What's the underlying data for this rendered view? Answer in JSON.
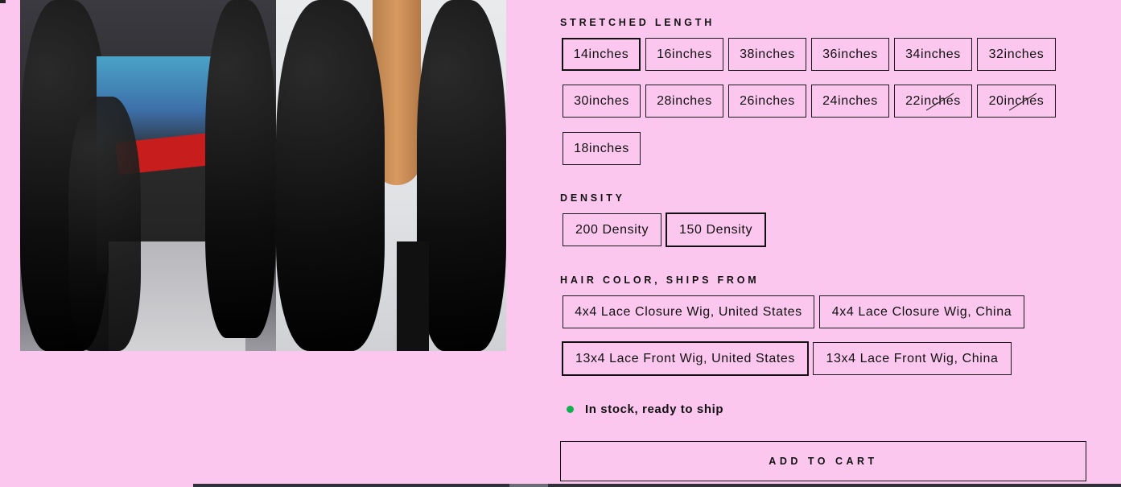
{
  "stretched_length": {
    "label": "STRETCHED LENGTH",
    "options": [
      {
        "label": "14inches",
        "selected": true,
        "sold_out": false
      },
      {
        "label": "16inches",
        "selected": false,
        "sold_out": false
      },
      {
        "label": "38inches",
        "selected": false,
        "sold_out": false
      },
      {
        "label": "36inches",
        "selected": false,
        "sold_out": false
      },
      {
        "label": "34inches",
        "selected": false,
        "sold_out": false
      },
      {
        "label": "32inches",
        "selected": false,
        "sold_out": false
      },
      {
        "label": "30inches",
        "selected": false,
        "sold_out": false
      },
      {
        "label": "28inches",
        "selected": false,
        "sold_out": false
      },
      {
        "label": "26inches",
        "selected": false,
        "sold_out": false
      },
      {
        "label": "24inches",
        "selected": false,
        "sold_out": false
      },
      {
        "label": "22inches",
        "selected": false,
        "sold_out": true
      },
      {
        "label": "20inches",
        "selected": false,
        "sold_out": true
      },
      {
        "label": "18inches",
        "selected": false,
        "sold_out": false
      }
    ]
  },
  "density": {
    "label": "DENSITY",
    "options": [
      {
        "label": "200 Density",
        "selected": false
      },
      {
        "label": "150 Density",
        "selected": true
      }
    ]
  },
  "hair_color": {
    "label": "HAIR COLOR, SHIPS FROM",
    "options": [
      {
        "label": "4x4 Lace Closure Wig, United States",
        "selected": false
      },
      {
        "label": "4x4 Lace Closure Wig, China",
        "selected": false
      },
      {
        "label": "13x4 Lace Front Wig, United States",
        "selected": true
      },
      {
        "label": "13x4 Lace Front Wig, China",
        "selected": false
      }
    ]
  },
  "stock": {
    "text": "In stock, ready to ship",
    "dot_color": "#0fb04d"
  },
  "cart": {
    "button_label": "ADD TO CART"
  },
  "colors": {
    "background": "#fcc7ee",
    "border": "#1a1a1a"
  }
}
